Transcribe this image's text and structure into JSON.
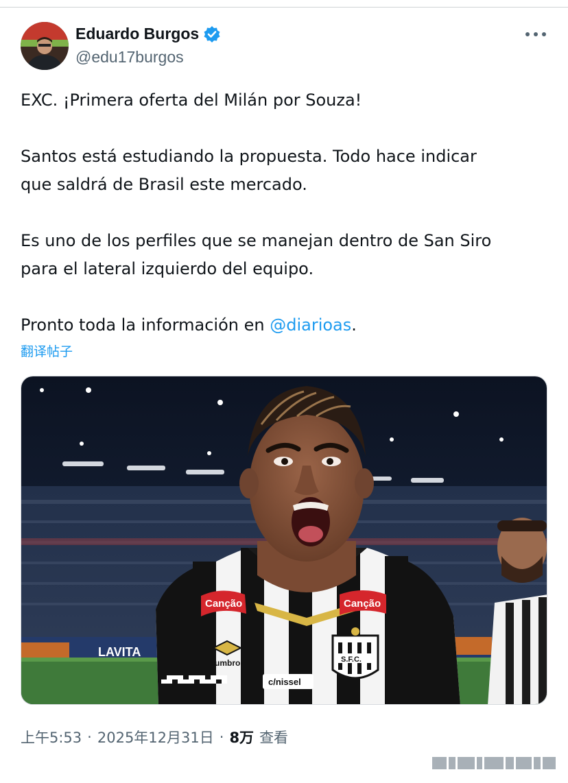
{
  "author": {
    "name": "Eduardo Burgos",
    "handle": "@edu17burgos",
    "verified": true
  },
  "tweet": {
    "line1": "EXC. ¡Primera oferta del Milán por Souza!",
    "para2_line1": "Santos está estudiando la propuesta. Todo hace indicar",
    "para2_line2": "que saldrá de Brasil este mercado.",
    "para3_line1": "Es uno de los perfiles que se manejan dentro de San Siro",
    "para3_line2": "para el lateral izquierdo del equipo.",
    "para4_prefix": "Pronto toda la información en ",
    "para4_mention": "@diarioas",
    "para4_suffix": "."
  },
  "translate_label": "翻译帖子",
  "media": {
    "jersey_sponsor": "Canção",
    "jersey_brand": "umbro",
    "jersey_bottom": "c/nissel",
    "crest": "S.F.C.",
    "board_text": "LAVITA"
  },
  "meta": {
    "time": "上午5:53",
    "separator": "·",
    "date": "2025年12月31日",
    "views": "8万",
    "views_label": "查看"
  },
  "colors": {
    "accent": "#1d9bf0",
    "secondary_text": "#536471",
    "primary_text": "#0f1419"
  }
}
